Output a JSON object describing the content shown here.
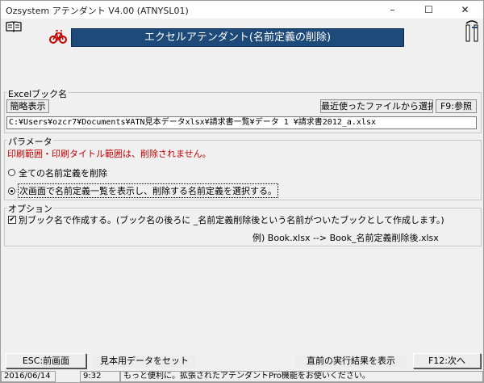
{
  "window": {
    "title": "Ozsystem アテンダント V4.00 (ATNYSL01)",
    "minimize": "–",
    "maximize": "☐",
    "close": "✕"
  },
  "banner": {
    "text": "エクセルアテンダント(名前定義の削除)"
  },
  "workbook": {
    "group_label": "Excelブック名",
    "short_display_button": "簡略表示",
    "recent_files_button": "最近使ったファイルから選択",
    "browse_button": "F9:参照",
    "path_value": "C:¥Users¥ozcr7¥Documents¥ATN見本データxlsx¥請求書一覧¥データ 1 ¥請求書2012_a.xlsx"
  },
  "parameters": {
    "group_label": "パラメータ",
    "warning": "印刷範囲・印刷タイトル範囲は、削除されません。",
    "option1": "全ての名前定義を削除",
    "option2": "次画面で名前定義一覧を表示し、削除する名前定義を選択する。",
    "selected": "option2"
  },
  "options": {
    "group_label": "オプション",
    "save_as_label": "別ブック名で作成する。(ブック名の後ろに _名前定義削除後という名前がついたブックとして作成します。)",
    "save_as_checked": true,
    "example": "例) Book.xlsx --> Book_名前定義削除後.xlsx"
  },
  "footer": {
    "esc_button": "ESC:前画面",
    "sample_button": "見本用データをセット",
    "last_result_button": "直前の実行結果を表示",
    "next_button": "F12:次へ"
  },
  "statusbar": {
    "date": "2016/06/14",
    "time": "9:32",
    "message": "もっと便利に。拡張されたアテンダントPro機能をお使いください。"
  },
  "colors": {
    "banner": "#1d4a78",
    "warning": "#c00000"
  }
}
